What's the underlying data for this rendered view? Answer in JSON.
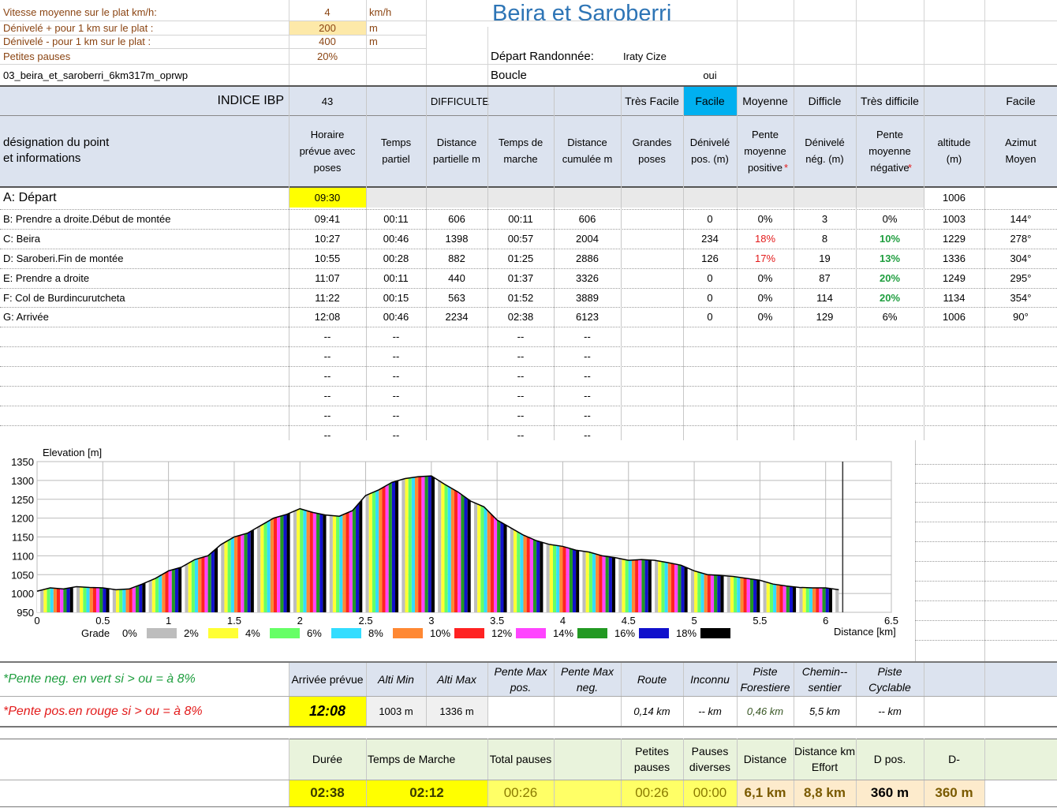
{
  "top": {
    "r1": {
      "label": "Vitesse moyenne sur le plat  km/h:",
      "value": "4",
      "unit": "km/h"
    },
    "r2": {
      "label": "Dénivelé + pour 1 km sur le plat :",
      "value": "200",
      "unit": "m"
    },
    "r3": {
      "label": "Dénivelé - pour 1 km sur le plat :",
      "value": "400",
      "unit": "m"
    },
    "r4": {
      "label": "Petites pauses",
      "value": "20%"
    },
    "file": "03_beira_et_saroberri_6km317m_oprwp",
    "title": "Beira et Saroberri",
    "depart_label": "Départ Randonnée:",
    "depart_value": "Iraty Cize",
    "boucle_label": "Boucle",
    "boucle_value": "oui"
  },
  "ibp": {
    "label": "INDICE IBP",
    "value": "43",
    "difficulte": "DIFFICULTE",
    "levels": [
      "Très Facile",
      "Facile",
      "Moyenne",
      "Difficle",
      "Très difficile"
    ],
    "active": "Facile",
    "right": "Facile"
  },
  "columns": {
    "designation": "désignation du point\net informations",
    "horaire": "Horaire prévue  avec poses",
    "temps_partiel": "Temps partiel",
    "dist_part": "Distance partielle m",
    "temps_marche": "Temps de marche",
    "dist_cum": "Distance cumulée m",
    "grandes_poses": "Grandes poses",
    "den_pos": "Dénivelé pos. (m)",
    "pente_pos": "Pente moyenne positive",
    "den_neg": "Dénivelé nég. (m)",
    "pente_neg": "Pente moyenne négative",
    "altitude": "altitude (m)",
    "azimut": "Azimut Moyen",
    "star": "*"
  },
  "rows": [
    {
      "name": "A: Départ",
      "horaire": "09:30",
      "tp": "",
      "dp": "",
      "tm": "",
      "dc": "",
      "gp": "",
      "dpos": "",
      "ppos": "",
      "dneg": "",
      "pneg": "",
      "alt": "1006",
      "az": ""
    },
    {
      "name": "B: Prendre a droite.Début de montée",
      "horaire": "09:41",
      "tp": "00:11",
      "dp": "606",
      "tm": "00:11",
      "dc": "606",
      "gp": "",
      "dpos": "0",
      "ppos": "0%",
      "dneg": "3",
      "pneg": "0%",
      "alt": "1003",
      "az": "144°"
    },
    {
      "name": "C: Beira",
      "horaire": "10:27",
      "tp": "00:46",
      "dp": "1398",
      "tm": "00:57",
      "dc": "2004",
      "gp": "",
      "dpos": "234",
      "ppos": "18%",
      "dneg": "8",
      "pneg": "10%",
      "alt": "1229",
      "az": "278°"
    },
    {
      "name": "D: Saroberi.Fin de montée",
      "horaire": "10:55",
      "tp": "00:28",
      "dp": "882",
      "tm": "01:25",
      "dc": "2886",
      "gp": "",
      "dpos": "126",
      "ppos": "17%",
      "dneg": "19",
      "pneg": "13%",
      "alt": "1336",
      "az": "304°"
    },
    {
      "name": "E: Prendre a droite",
      "horaire": "11:07",
      "tp": "00:11",
      "dp": "440",
      "tm": "01:37",
      "dc": "3326",
      "gp": "",
      "dpos": "0",
      "ppos": "0%",
      "dneg": "87",
      "pneg": "20%",
      "alt": "1249",
      "az": "295°"
    },
    {
      "name": "F: Col de Burdincurutcheta",
      "horaire": "11:22",
      "tp": "00:15",
      "dp": "563",
      "tm": "01:52",
      "dc": "3889",
      "gp": "",
      "dpos": "0",
      "ppos": "0%",
      "dneg": "114",
      "pneg": "20%",
      "alt": "1134",
      "az": "354°"
    },
    {
      "name": "G: Arrivée",
      "horaire": "12:08",
      "tp": "00:46",
      "dp": "2234",
      "tm": "02:38",
      "dc": "6123",
      "gp": "",
      "dpos": "0",
      "ppos": "0%",
      "dneg": "129",
      "pneg": "6%",
      "alt": "1006",
      "az": "90°"
    }
  ],
  "dash": "--",
  "chart_data": {
    "type": "area",
    "ylabel": "Elevation [m]",
    "xlabel": "Distance [km]",
    "xlim": [
      0,
      6.5
    ],
    "ylim": [
      950,
      1350
    ],
    "xticks": [
      "0",
      "0.5",
      "1",
      "1.5",
      "2",
      "2.5",
      "3",
      "3.5",
      "4",
      "4.5",
      "5",
      "5.5",
      "6",
      "6.5"
    ],
    "yticks": [
      "950",
      "1000",
      "1050",
      "1100",
      "1150",
      "1200",
      "1250",
      "1300",
      "1350"
    ],
    "grid": true,
    "x": [
      0,
      0.1,
      0.2,
      0.3,
      0.4,
      0.5,
      0.6,
      0.7,
      0.8,
      0.9,
      1.0,
      1.1,
      1.2,
      1.3,
      1.4,
      1.5,
      1.6,
      1.7,
      1.8,
      1.9,
      2.0,
      2.1,
      2.2,
      2.3,
      2.4,
      2.5,
      2.6,
      2.7,
      2.8,
      2.9,
      3.0,
      3.1,
      3.2,
      3.3,
      3.4,
      3.5,
      3.6,
      3.7,
      3.8,
      3.9,
      4.0,
      4.1,
      4.2,
      4.3,
      4.4,
      4.5,
      4.6,
      4.7,
      4.8,
      4.9,
      5.0,
      5.1,
      5.2,
      5.3,
      5.4,
      5.5,
      5.6,
      5.7,
      5.8,
      5.9,
      6.0,
      6.1
    ],
    "y": [
      1006,
      1015,
      1012,
      1018,
      1016,
      1015,
      1010,
      1012,
      1025,
      1040,
      1060,
      1070,
      1090,
      1100,
      1130,
      1150,
      1160,
      1180,
      1200,
      1210,
      1225,
      1215,
      1208,
      1205,
      1220,
      1260,
      1275,
      1295,
      1305,
      1310,
      1312,
      1290,
      1270,
      1245,
      1230,
      1195,
      1175,
      1155,
      1140,
      1130,
      1125,
      1115,
      1110,
      1100,
      1095,
      1088,
      1090,
      1088,
      1082,
      1075,
      1060,
      1050,
      1048,
      1045,
      1040,
      1035,
      1025,
      1020,
      1016,
      1015,
      1015,
      1010
    ],
    "grade_legend": {
      "label": "Grade",
      "items": [
        "0%",
        "2%",
        "4%",
        "6%",
        "8%",
        "10%",
        "12%",
        "14%",
        "16%",
        "18%"
      ]
    },
    "grade_colors": [
      "#ffffff",
      "#bdbdbd",
      "#ffff33",
      "#66ff66",
      "#33ddff",
      "#ff8833",
      "#ff2222",
      "#ff44ff",
      "#229922",
      "#1111cc",
      "#000000"
    ]
  },
  "notes": {
    "neg": "*Pente neg. en vert si > ou = à 8%",
    "pos": "*Pente pos.en rouge si > ou = à 8%"
  },
  "summary1": {
    "headers": [
      "Arrivée prévue",
      "Alti Min",
      "Alti Max",
      "Pente Max pos.",
      "Pente Max neg.",
      "Route",
      "Inconnu",
      "Piste Forestiere",
      "Chemin--sentier",
      "Piste Cyclable"
    ],
    "values": [
      "12:08",
      "1003 m",
      "1336 m",
      "",
      "",
      "0,14 km",
      "-- km",
      "0,46 km",
      "5,5 km",
      "-- km"
    ]
  },
  "summary2": {
    "headers": [
      "Durée",
      "Temps de Marche",
      "Total pauses",
      "",
      "Petites pauses",
      "Pauses diverses",
      "Distance",
      "Distance km Effort",
      "D pos.",
      "D-"
    ],
    "values": [
      "02:38",
      "02:12",
      "00:26",
      "",
      "00:26",
      "00:00",
      "6,1 km",
      "8,8 km",
      "360 m",
      "360 m"
    ]
  },
  "colors": {
    "header": "#dce3ef",
    "active": "#00b0f0",
    "title": "#2e75b6",
    "label": "#8b4513",
    "yellow": "#ffff00",
    "input": "#fde9a9"
  }
}
